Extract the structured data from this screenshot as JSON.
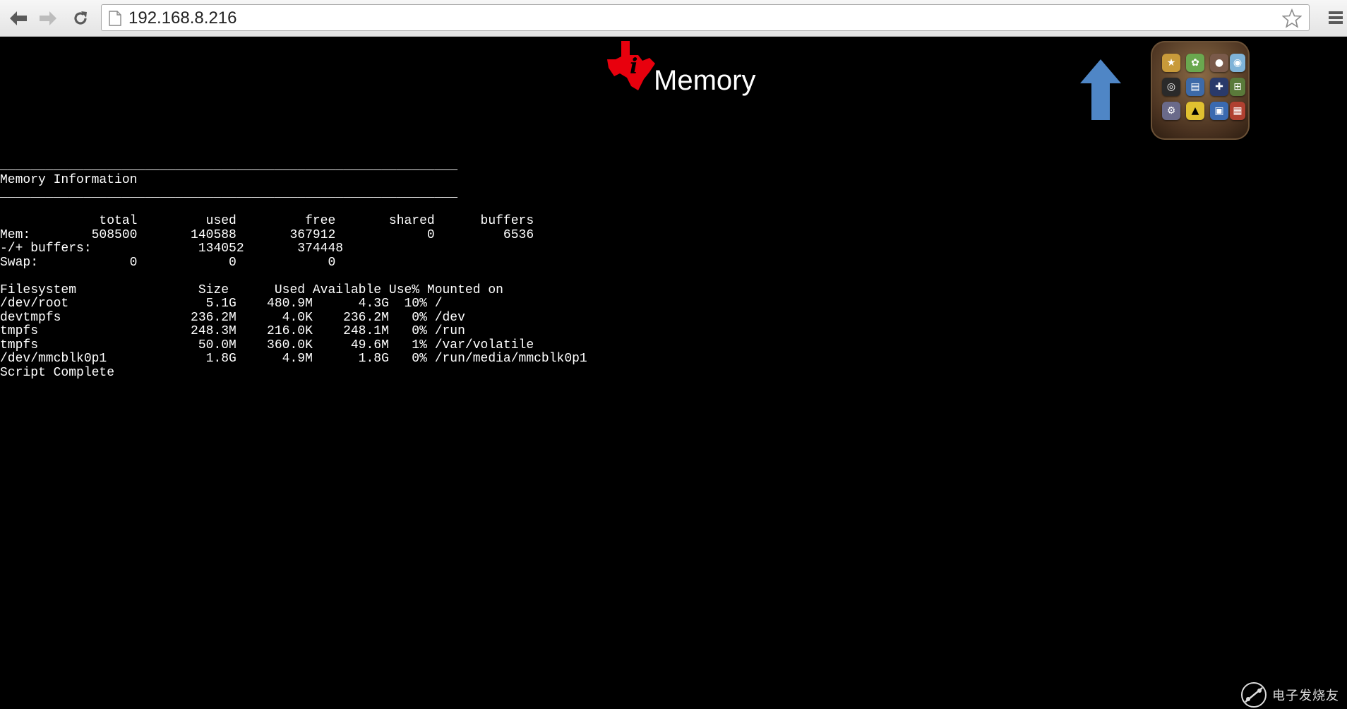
{
  "browser": {
    "url": "192.168.8.216",
    "icons": {
      "back": "arrow-left-icon",
      "forward": "arrow-right-icon",
      "reload": "reload-icon",
      "page": "page-icon",
      "bookmark": "star-icon",
      "menu": "hamburger-menu-icon"
    }
  },
  "header": {
    "title": "Memory",
    "logo": "texas-instruments-logo",
    "accent_color": "#e8000d"
  },
  "nav": {
    "up_icon": "up-arrow-icon",
    "up_color": "#4f86c6",
    "apps_icon": "app-folder-icon"
  },
  "terminal": {
    "lines": [
      "____________________________________________________________",
      "Memory Information",
      "____________________________________________________________",
      "",
      "             total         used         free       shared      buffers",
      "Mem:        508500       140588       367912            0         6536",
      "-/+ buffers:              134052       374448",
      "Swap:            0            0            0",
      "",
      "Filesystem                Size      Used Available Use% Mounted on",
      "/dev/root                  5.1G    480.9M      4.3G  10% /",
      "devtmpfs                 236.2M      4.0K    236.2M   0% /dev",
      "tmpfs                    248.3M    216.0K    248.1M   0% /run",
      "tmpfs                     50.0M    360.0K     49.6M   1% /var/volatile",
      "/dev/mmcblk0p1             1.8G      4.9M      1.8G   0% /run/media/mmcblk0p1",
      "Script Complete"
    ]
  },
  "watermark": {
    "text": "电子发烧友"
  }
}
